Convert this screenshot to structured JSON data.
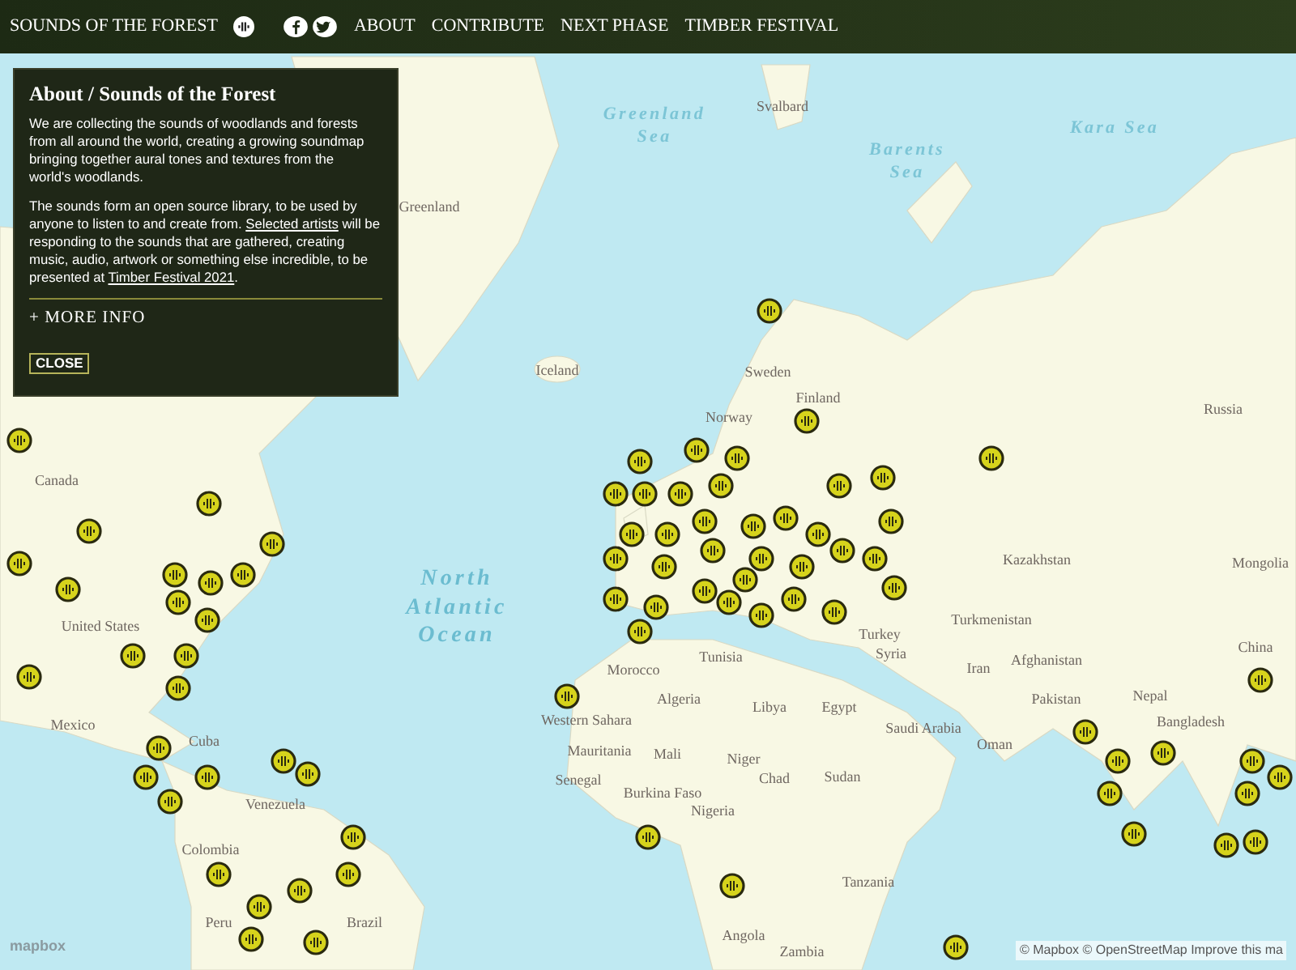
{
  "nav": {
    "title": "SOUNDS OF THE FOREST",
    "links": [
      "ABOUT",
      "CONTRIBUTE",
      "NEXT PHASE",
      "TIMBER FESTIVAL"
    ]
  },
  "about_panel": {
    "title": "About / Sounds of the Forest",
    "paragraph_1": "We are collecting the sounds of woodlands and forests from all around the world, creating a growing soundmap bringing together aural tones and textures from the world's woodlands.",
    "paragraph_2": {
      "before": "The sounds form an open source library, to be used by anyone to listen to and create from. ",
      "link_1": "Selected artists",
      "middle": " will be responding to the sounds that are gathered, creating music, audio, artwork or something else incredible, to be presented at ",
      "link_2": "Timber Festival 2021",
      "after": "."
    },
    "more_info": "+ MORE INFO",
    "close_button": "CLOSE"
  },
  "map": {
    "labels": [
      {
        "text": "Greenland Sea",
        "kind": "sea"
      },
      {
        "text": "Svalbard",
        "kind": "place"
      },
      {
        "text": "Barents Sea",
        "kind": "sea"
      },
      {
        "text": "Kara Sea",
        "kind": "sea"
      },
      {
        "text": "Greenland",
        "kind": "place"
      },
      {
        "text": "Iceland",
        "kind": "place"
      },
      {
        "text": "Sweden",
        "kind": "place"
      },
      {
        "text": "Finland",
        "kind": "place"
      },
      {
        "text": "Norway",
        "kind": "place"
      },
      {
        "text": "Russia",
        "kind": "place"
      },
      {
        "text": "Canada",
        "kind": "place"
      },
      {
        "text": "Kazakhstan",
        "kind": "place"
      },
      {
        "text": "Mongolia",
        "kind": "place"
      },
      {
        "text": "United States",
        "kind": "place"
      },
      {
        "text": "North Atlantic Ocean",
        "kind": "ocean"
      },
      {
        "text": "Turkey",
        "kind": "place"
      },
      {
        "text": "Turkmenistan",
        "kind": "place"
      },
      {
        "text": "Morocco",
        "kind": "place"
      },
      {
        "text": "Tunisia",
        "kind": "place"
      },
      {
        "text": "Syria",
        "kind": "place"
      },
      {
        "text": "Iran",
        "kind": "place"
      },
      {
        "text": "Afghanistan",
        "kind": "place"
      },
      {
        "text": "China",
        "kind": "place"
      },
      {
        "text": "Algeria",
        "kind": "place"
      },
      {
        "text": "Libya",
        "kind": "place"
      },
      {
        "text": "Egypt",
        "kind": "place"
      },
      {
        "text": "Pakistan",
        "kind": "place"
      },
      {
        "text": "Nepal",
        "kind": "place"
      },
      {
        "text": "Mexico",
        "kind": "place"
      },
      {
        "text": "Cuba",
        "kind": "place"
      },
      {
        "text": "Western Sahara",
        "kind": "place"
      },
      {
        "text": "Saudi Arabia",
        "kind": "place"
      },
      {
        "text": "Bangladesh",
        "kind": "place"
      },
      {
        "text": "Mauritania",
        "kind": "place"
      },
      {
        "text": "Mali",
        "kind": "place"
      },
      {
        "text": "Niger",
        "kind": "place"
      },
      {
        "text": "Chad",
        "kind": "place"
      },
      {
        "text": "Sudan",
        "kind": "place"
      },
      {
        "text": "Oman",
        "kind": "place"
      },
      {
        "text": "Senegal",
        "kind": "place"
      },
      {
        "text": "Burkina Faso",
        "kind": "place"
      },
      {
        "text": "Nigeria",
        "kind": "place"
      },
      {
        "text": "Venezuela",
        "kind": "place"
      },
      {
        "text": "Colombia",
        "kind": "place"
      },
      {
        "text": "Tanzania",
        "kind": "place"
      },
      {
        "text": "Peru",
        "kind": "place"
      },
      {
        "text": "Brazil",
        "kind": "place"
      },
      {
        "text": "Angola",
        "kind": "place"
      },
      {
        "text": "Zambia",
        "kind": "place"
      }
    ],
    "logo": "mapbox",
    "attribution": "© Mapbox © OpenStreetMap Improve this ma"
  }
}
